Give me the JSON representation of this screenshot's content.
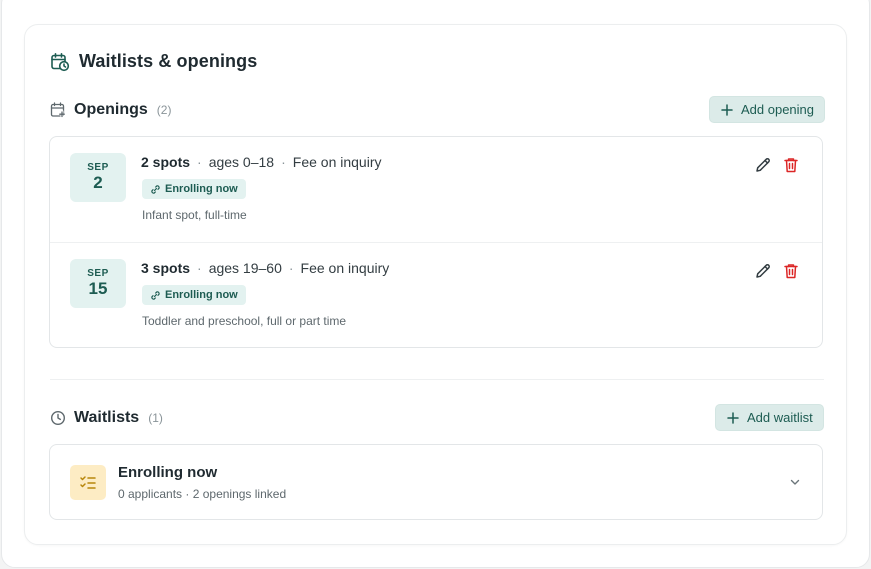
{
  "card": {
    "title": "Waitlists & openings",
    "title_icon": "calendar-clock-icon"
  },
  "openings": {
    "heading": "Openings",
    "count": "(2)",
    "add_label": "Add opening",
    "items": [
      {
        "month": "SEP",
        "day": "2",
        "spots": "2 spots",
        "ages": "ages 0–18",
        "fee": "Fee on inquiry",
        "status": "Enrolling now",
        "note": "Infant spot, full-time"
      },
      {
        "month": "SEP",
        "day": "15",
        "spots": "3 spots",
        "ages": "ages 19–60",
        "fee": "Fee on inquiry",
        "status": "Enrolling now",
        "note": "Toddler and preschool, full or part time"
      }
    ]
  },
  "waitlists": {
    "heading": "Waitlists",
    "count": "(1)",
    "add_label": "Add waitlist",
    "items": [
      {
        "title": "Enrolling now",
        "subtitle": "0 applicants · 2 openings linked"
      }
    ]
  },
  "separator": "·",
  "colors": {
    "accent": "#1d5c52",
    "accent_bg": "#e3f2f0",
    "danger": "#dc2626",
    "waitlist_icon_bg": "#fdecc4"
  }
}
